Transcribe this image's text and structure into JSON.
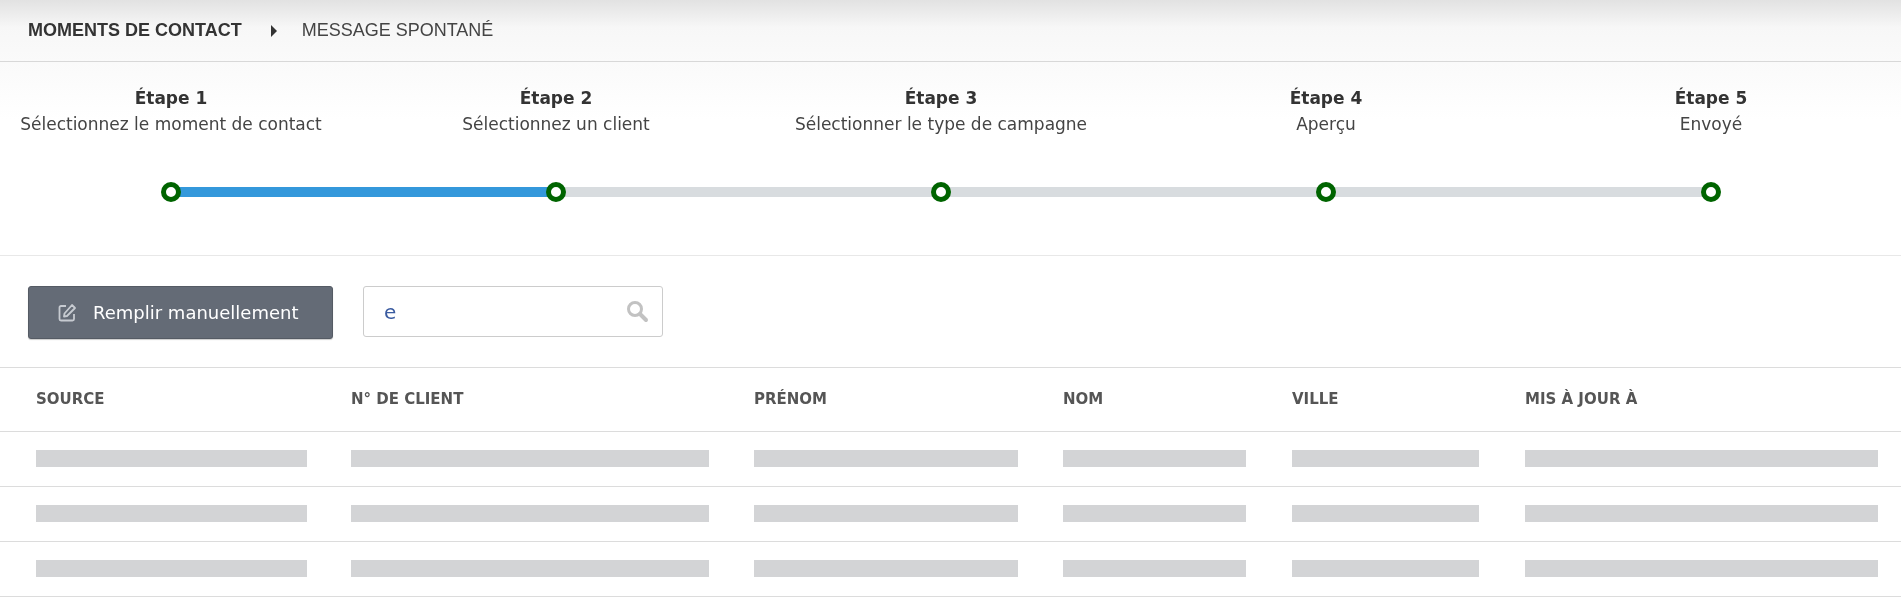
{
  "breadcrumb": {
    "parent": "MOMENTS DE CONTACT",
    "current": "MESSAGE SPONTANÉ"
  },
  "stepper": {
    "level": 0.25,
    "steps": [
      {
        "title": "Étape 1",
        "label": "Sélectionnez le moment de contact"
      },
      {
        "title": "Étape 2",
        "label": "Sélectionnez un client"
      },
      {
        "title": "Étape 3",
        "label": "Sélectionner le type de campagne"
      },
      {
        "title": "Étape 4",
        "label": "Aperçu"
      },
      {
        "title": "Étape 5",
        "label": "Envoyé"
      }
    ]
  },
  "toolbar": {
    "button": "Remplir manuellement",
    "search": {
      "value": "e"
    }
  },
  "table": {
    "columns": [
      "SOURCE",
      "N° DE CLIENT",
      "PRÉNOM",
      "NOM",
      "VILLE",
      "MIS À JOUR À"
    ],
    "rows": [
      {
        "kind": "skeleton"
      },
      {
        "kind": "skeleton"
      },
      {
        "kind": "skeleton"
      }
    ]
  }
}
